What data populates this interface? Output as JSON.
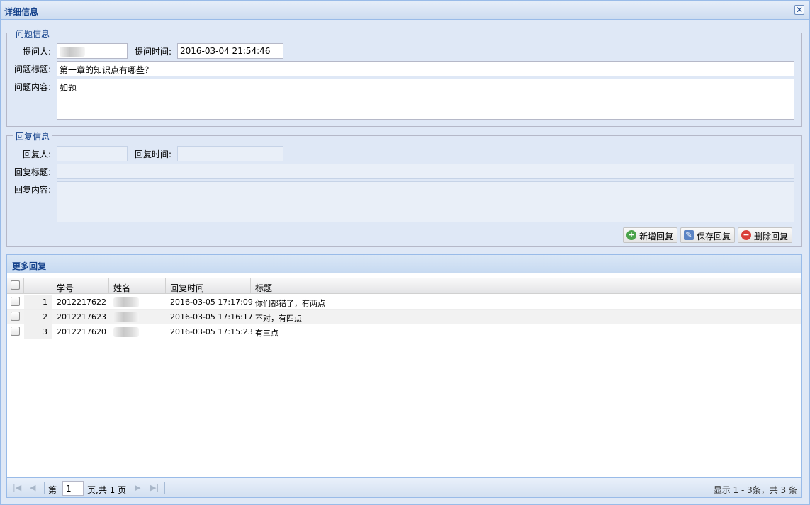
{
  "window": {
    "title": "详细信息"
  },
  "question": {
    "legend": "问题信息",
    "asker_label": "提问人:",
    "time_label": "提问时间:",
    "time_value": "2016-03-04 21:54:46",
    "title_label": "问题标题:",
    "title_value": "第一章的知识点有哪些？",
    "content_label": "问题内容:",
    "content_value": "如题"
  },
  "reply": {
    "legend": "回复信息",
    "replier_label": "回复人:",
    "time_label": "回复时间:",
    "title_label": "回复标题:",
    "content_label": "回复内容:",
    "buttons": {
      "add": "新增回复",
      "save": "保存回复",
      "delete": "删除回复"
    }
  },
  "more_replies": {
    "title": "更多回复",
    "columns": [
      "学号",
      "姓名",
      "回复时间",
      "标题"
    ],
    "rows": [
      {
        "num": "1",
        "student_id": "2012217622",
        "time": "2016-03-05 17:17:09",
        "title": "你们都错了，有两点"
      },
      {
        "num": "2",
        "student_id": "2012217623",
        "time": "2016-03-05 17:16:17",
        "title": "不对，有四点"
      },
      {
        "num": "3",
        "student_id": "2012217620",
        "time": "2016-03-05 17:15:23",
        "title": "有三点"
      }
    ]
  },
  "pager": {
    "page_prefix": "第",
    "page_value": "1",
    "page_suffix": "页,共 1 页",
    "info": "显示 1 - 3条，共 3 条"
  }
}
